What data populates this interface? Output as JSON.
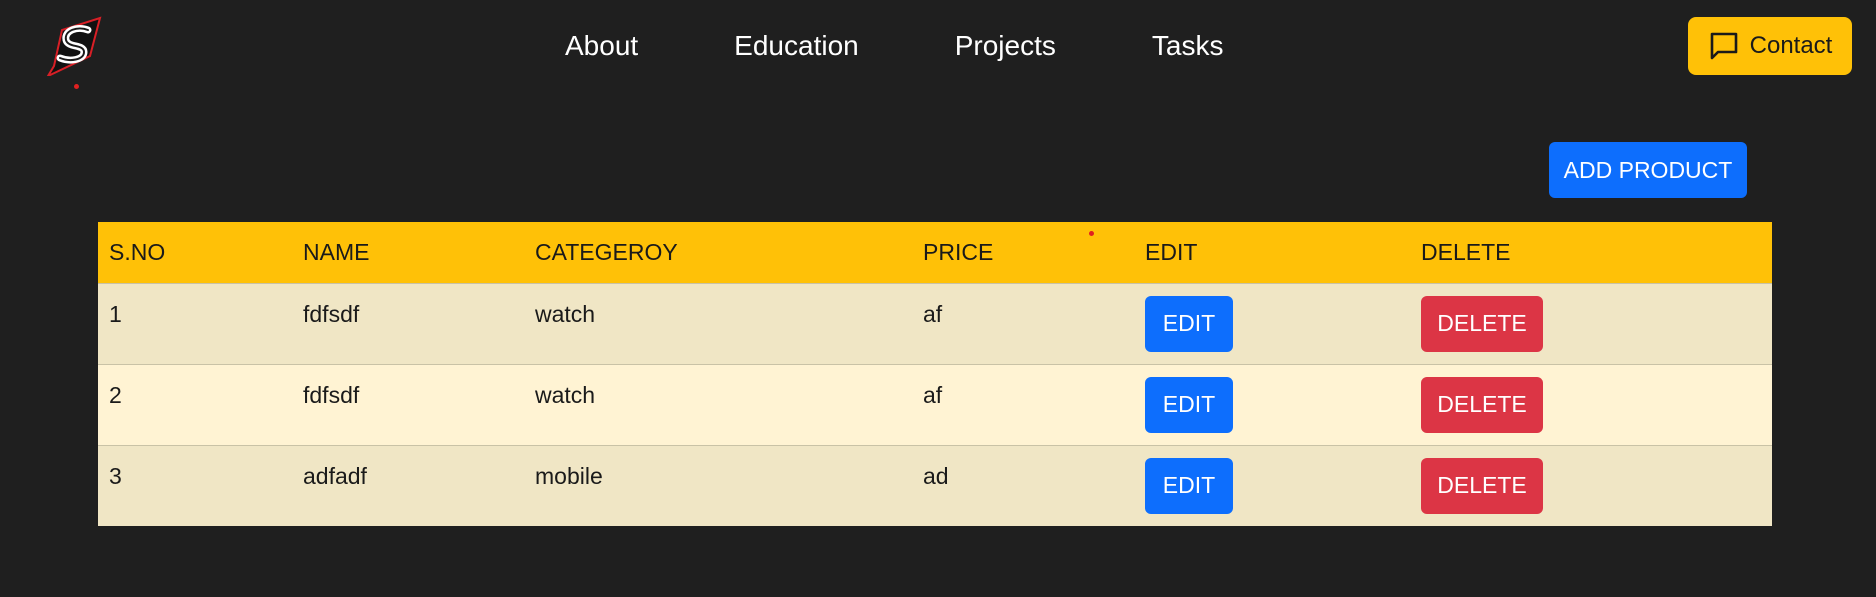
{
  "header": {
    "logo_letter": "S",
    "nav": [
      {
        "label": "About"
      },
      {
        "label": "Education"
      },
      {
        "label": "Projects"
      },
      {
        "label": "Tasks"
      }
    ],
    "contact_label": "Contact",
    "contact_icon": "chat-bubble-icon"
  },
  "actions": {
    "add_product_label": "ADD PRODUCT"
  },
  "table": {
    "headers": [
      "S.NO",
      "NAME",
      "CATEGEROY",
      "PRICE",
      "EDIT",
      "DELETE"
    ],
    "rows": [
      {
        "sno": "1",
        "name": "fdfsdf",
        "category": "watch",
        "price": "af",
        "edit": "EDIT",
        "delete": "DELETE"
      },
      {
        "sno": "2",
        "name": "fdfsdf",
        "category": "watch",
        "price": "af",
        "edit": "EDIT",
        "delete": "DELETE"
      },
      {
        "sno": "3",
        "name": "adfadf",
        "category": "mobile",
        "price": "ad",
        "edit": "EDIT",
        "delete": "DELETE"
      }
    ]
  },
  "colors": {
    "background": "#1f1f1f",
    "accent_yellow": "#ffc107",
    "primary_blue": "#0d6efd",
    "danger_red": "#dc3545",
    "row_odd": "#f0e6c5",
    "row_even": "#fff3d3"
  }
}
